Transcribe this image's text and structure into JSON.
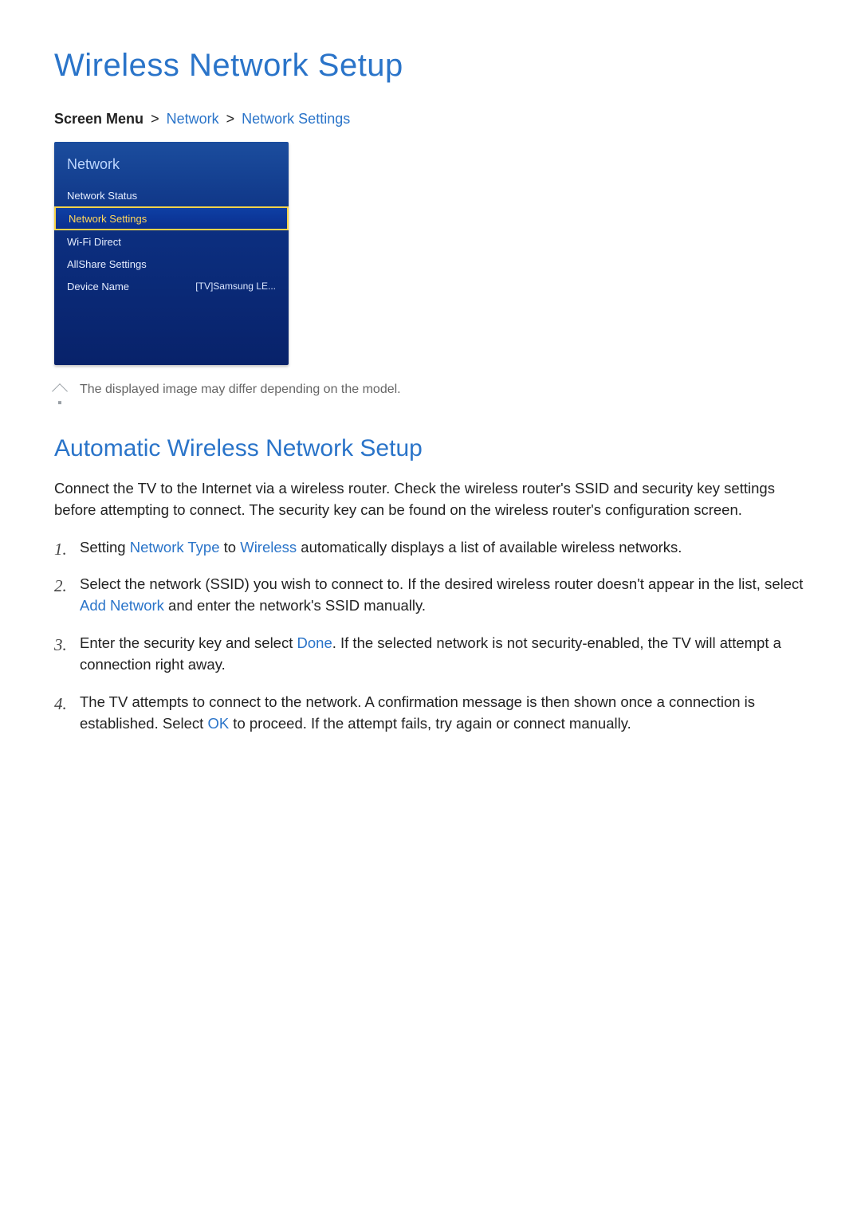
{
  "title": "Wireless Network Setup",
  "breadcrumb": {
    "prefix": "Screen Menu",
    "items": [
      "Network",
      "Network Settings"
    ]
  },
  "tv_panel": {
    "title": "Network",
    "rows": [
      {
        "label": "Network Status",
        "value": "",
        "selected": false
      },
      {
        "label": "Network Settings",
        "value": "",
        "selected": true
      },
      {
        "label": "Wi-Fi Direct",
        "value": "",
        "selected": false
      },
      {
        "label": "AllShare Settings",
        "value": "",
        "selected": false
      },
      {
        "label": "Device Name",
        "value": "[TV]Samsung LE...",
        "selected": false
      }
    ]
  },
  "note": "The displayed image may differ depending on the model.",
  "section_title": "Automatic Wireless Network Setup",
  "intro": "Connect the TV to the Internet via a wireless router. Check the wireless router's SSID and security key settings before attempting to connect. The security key can be found on the wireless router's configuration screen.",
  "steps": {
    "s1_a": "Setting ",
    "s1_hl1": "Network Type",
    "s1_b": " to ",
    "s1_hl2": "Wireless",
    "s1_c": " automatically displays a list of available wireless networks.",
    "s2_a": "Select the network (SSID) you wish to connect to. If the desired wireless router doesn't appear in the list, select ",
    "s2_hl1": "Add Network",
    "s2_b": " and enter the network's SSID manually.",
    "s3_a": "Enter the security key and select ",
    "s3_hl1": "Done",
    "s3_b": ". If the selected network is not security-enabled, the TV will attempt a connection right away.",
    "s4_a": "The TV attempts to connect to the network. A confirmation message is then shown once a connection is established. Select ",
    "s4_hl1": "OK",
    "s4_b": " to proceed. If the attempt fails, try again or connect manually."
  }
}
